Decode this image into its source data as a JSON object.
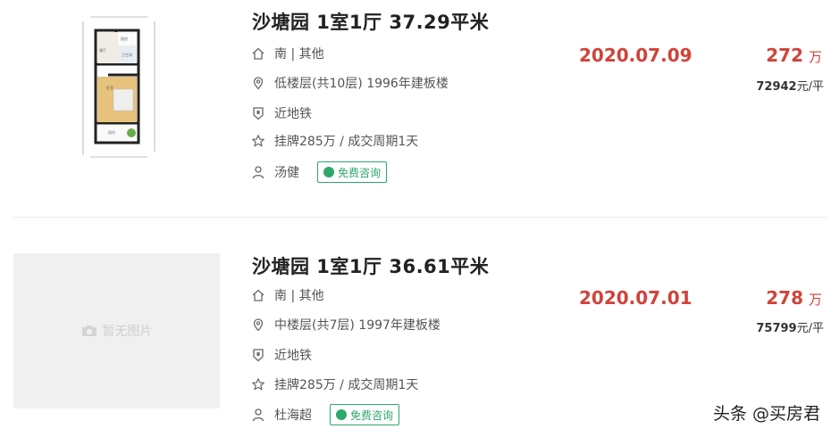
{
  "listings": [
    {
      "title": "沙塘园 1室1厅 37.29平米",
      "orientation": "南 | 其他",
      "floor": "低楼层(共10层) 1996年建板楼",
      "subway": "近地铁",
      "listing_info": "挂牌285万 / 成交周期1天",
      "agent": "汤健",
      "consult_label": "免费咨询",
      "deal_date": "2020.07.09",
      "total_price": "272",
      "price_unit": "万",
      "unit_price": "72942",
      "unit_price_suffix": "元/平",
      "image": "floor-plan"
    },
    {
      "title": "沙塘园 1室1厅 36.61平米",
      "orientation": "南 | 其他",
      "floor": "中楼层(共7层) 1997年建板楼",
      "subway": "近地铁",
      "listing_info": "挂牌285万 / 成交周期1天",
      "agent": "杜海超",
      "consult_label": "免费咨询",
      "deal_date": "2020.07.01",
      "total_price": "278",
      "price_unit": "万",
      "unit_price": "75799",
      "unit_price_suffix": "元/平",
      "image": "none",
      "no_image_text": "暂无图片"
    }
  ],
  "watermark": "头条 @买房君",
  "colors": {
    "accent": "#d0433a",
    "consult": "#2ea86b",
    "text": "#333333"
  },
  "icons": [
    "home-icon",
    "location-pin-icon",
    "subway-shield-icon",
    "star-icon",
    "person-icon",
    "chat-bubble-icon",
    "camera-icon"
  ]
}
